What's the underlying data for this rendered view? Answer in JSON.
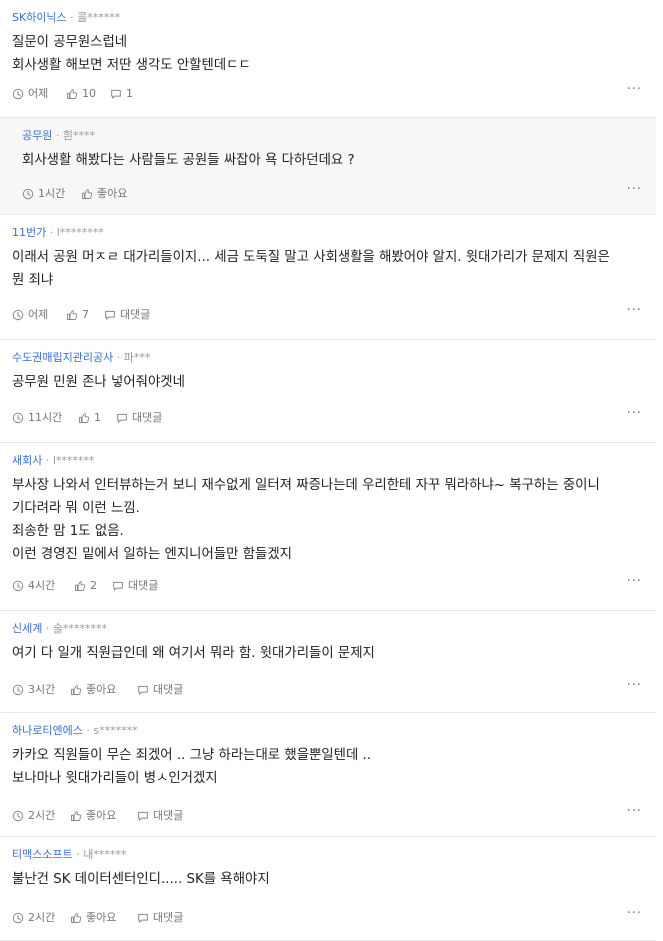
{
  "ui": {
    "like_label": "좋아요",
    "reply_label": "대댓글",
    "more_glyph": "···"
  },
  "comments": [
    {
      "company": "SK하이닉스",
      "author": "콜******",
      "lines": [
        "질문이 공무원스럽네",
        "회사생활 해보면 저딴 생각도 안할텐데ㄷㄷ"
      ],
      "time": "어제",
      "likes": "10",
      "replies": "1"
    },
    {
      "company": "공무원",
      "author": "흰****",
      "lines": [
        "회사생활 해봤다는 사람들도 공원들 싸잡아 욕 다하던데요 ?"
      ],
      "time": "1시간",
      "likes": "좋아요"
    },
    {
      "company": "11번가",
      "author": "l********",
      "lines": [
        "이래서 공원 머ㅈㄹ 대가리들이지... 세금 도둑질 말고 사회생활을 해봤어야 알지. 윗대가리가 문제지 직원은",
        "뭔 죄냐"
      ],
      "time": "어제",
      "likes": "7",
      "replies": "대댓글"
    },
    {
      "company": "수도권매립지관리공사",
      "author": "파***",
      "lines": [
        "공무원 민원 존나 넣어줘야겟네"
      ],
      "time": "11시간",
      "likes": "1",
      "replies": "대댓글"
    },
    {
      "company": "새회사",
      "author": "l*******",
      "lines": [
        "부사장 나와서 인터뷰하는거 보니 재수없게 일터져 짜증나는데 우리한테 자꾸 뭐라하냐~ 복구하는 중이니",
        "기다려라 뭐 이런 느낌.",
        "죄송한 맘 1도 없음.",
        "이런 경영진 밑에서 일하는 엔지니어들만 함들겠지"
      ],
      "time": "4시간",
      "likes": "2",
      "replies": "대댓글"
    },
    {
      "company": "신세계",
      "author": "술********",
      "lines": [
        "여기 다 일개 직원급인데 왜 여기서 뭐라 함. 윗대가리들이 문제지"
      ],
      "time": "3시간",
      "likes": "좋아요",
      "replies": "대댓글"
    },
    {
      "company": "하나로티엔에스",
      "author": "s*******",
      "lines": [
        "카카오 직원들이 무슨 죄겠어 .. 그냥 하라는대로 했을뿐일텐데 ..",
        "보나마나 윗대가리들이 병ㅅ인거겠지"
      ],
      "time": "2시간",
      "likes": "좋아요",
      "replies": "대댓글"
    },
    {
      "company": "티맥스소프트",
      "author": "내******",
      "lines": [
        "불난건 SK 데이터센터인디..... SK를 욕해야지"
      ],
      "time": "2시간",
      "likes": "좋아요",
      "replies": "대댓글"
    }
  ]
}
